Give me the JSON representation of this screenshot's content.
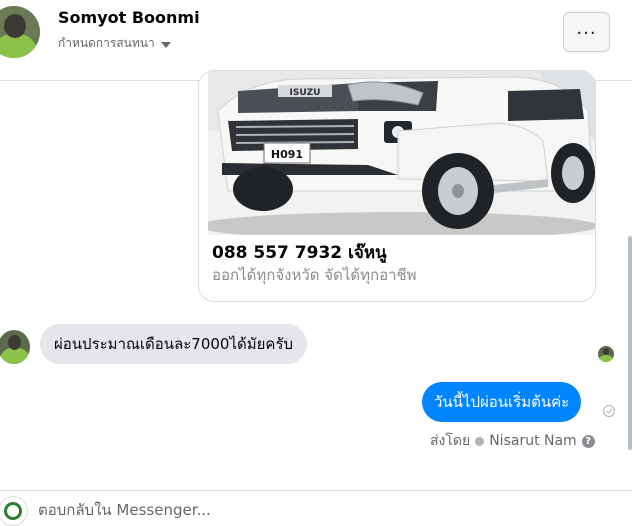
{
  "header": {
    "contact_name": "Somyot Boonmi",
    "manage_label": "กำหนดการสนทนา",
    "more_label": "..."
  },
  "card": {
    "plate_text": "H091",
    "brand_text": "ISUZU",
    "phone": "088 557 7932 เจ๊หนู",
    "description": "ออกได้ทุกจังหวัด จัดได้ทุกอาชีพ"
  },
  "messages": {
    "incoming": "ผ่อนประมาณเดือนละ7000ได้มัยครับ",
    "outgoing": "วันนี้ไปผ่อนเริ่มต้นค่ะ",
    "sent_by_label": "ส่งโดย",
    "sender_name": "Nisarut Nam",
    "help": "?"
  },
  "composer": {
    "placeholder": "ตอบกลับใน Messenger..."
  },
  "colors": {
    "accent": "#0084ff",
    "incoming_bubble": "#e4e6eb"
  }
}
